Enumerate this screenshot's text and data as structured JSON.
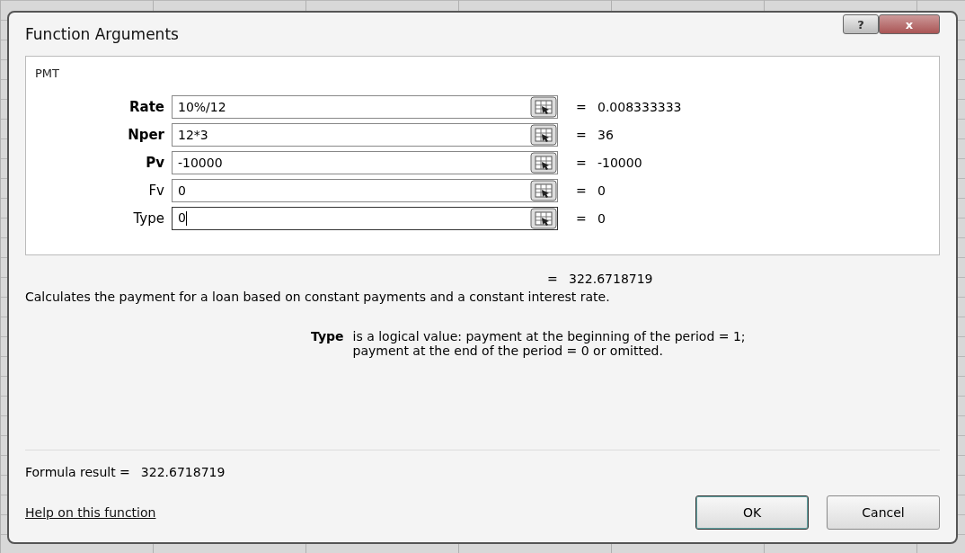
{
  "window": {
    "title": "Function Arguments",
    "help_button": "?",
    "close_button": "x"
  },
  "function_name": "PMT",
  "arguments": [
    {
      "label": "Rate",
      "required": true,
      "value": "10%/12",
      "result": "0.008333333",
      "focused": false
    },
    {
      "label": "Nper",
      "required": true,
      "value": "12*3",
      "result": "36",
      "focused": false
    },
    {
      "label": "Pv",
      "required": true,
      "value": "-10000",
      "result": "-10000",
      "focused": false
    },
    {
      "label": "Fv",
      "required": false,
      "value": "0",
      "result": "0",
      "focused": false
    },
    {
      "label": "Type",
      "required": false,
      "value": "0",
      "result": "0",
      "focused": true
    }
  ],
  "equals": "=",
  "result": "322.6718719",
  "description": "Calculates the payment for a loan based on constant payments and a constant interest rate.",
  "argument_help": {
    "name": "Type",
    "text": "is a logical value: payment at the beginning of the period = 1;\npayment at the end of the period = 0 or omitted."
  },
  "formula_result": {
    "label": "Formula result =",
    "value": "322.6718719"
  },
  "help_link": "Help on this function",
  "buttons": [
    {
      "label": "OK",
      "default": true
    },
    {
      "label": "Cancel",
      "default": false
    }
  ]
}
